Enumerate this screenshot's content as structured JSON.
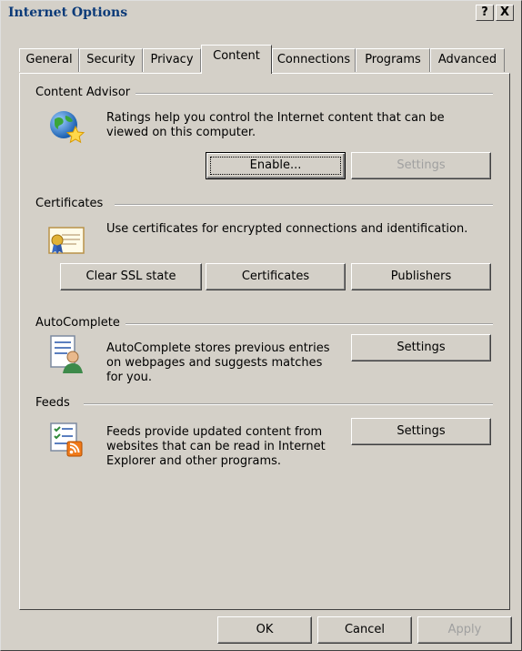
{
  "window": {
    "title": "Internet Options",
    "help_button": "?",
    "close_button": "X"
  },
  "tabs": [
    "General",
    "Security",
    "Privacy",
    "Content",
    "Connections",
    "Programs",
    "Advanced"
  ],
  "active_tab": "Content",
  "content_advisor": {
    "title": "Content Advisor",
    "description_line1": "Ratings help you control the Internet content that can be",
    "description_line2": "viewed on this computer.",
    "enable_button": "Enable...",
    "settings_button": "Settings",
    "icon": "globe-star-icon"
  },
  "certificates": {
    "title": "Certificates",
    "description": "Use certificates for encrypted connections and identification.",
    "clear_ssl_button": "Clear SSL state",
    "certificates_button": "Certificates",
    "publishers_button": "Publishers",
    "icon": "certificate-icon"
  },
  "autocomplete": {
    "title": "AutoComplete",
    "description_line1": "AutoComplete stores previous entries",
    "description_line2": "on webpages and suggests matches",
    "description_line3": "for you.",
    "settings_button": "Settings",
    "icon": "autocomplete-person-icon"
  },
  "feeds": {
    "title": "Feeds",
    "description_line1": "Feeds provide updated content from",
    "description_line2": "websites that can be read in Internet",
    "description_line3": "Explorer and other programs.",
    "settings_button": "Settings",
    "icon": "feed-list-icon"
  },
  "footer": {
    "ok_button": "OK",
    "cancel_button": "Cancel",
    "apply_button": "Apply"
  },
  "colors": {
    "dialog_bg": "#d4d0c8",
    "title_text": "#0b3a78",
    "disabled_text": "#a0a0a0",
    "rss_orange": "#f07a1a"
  }
}
